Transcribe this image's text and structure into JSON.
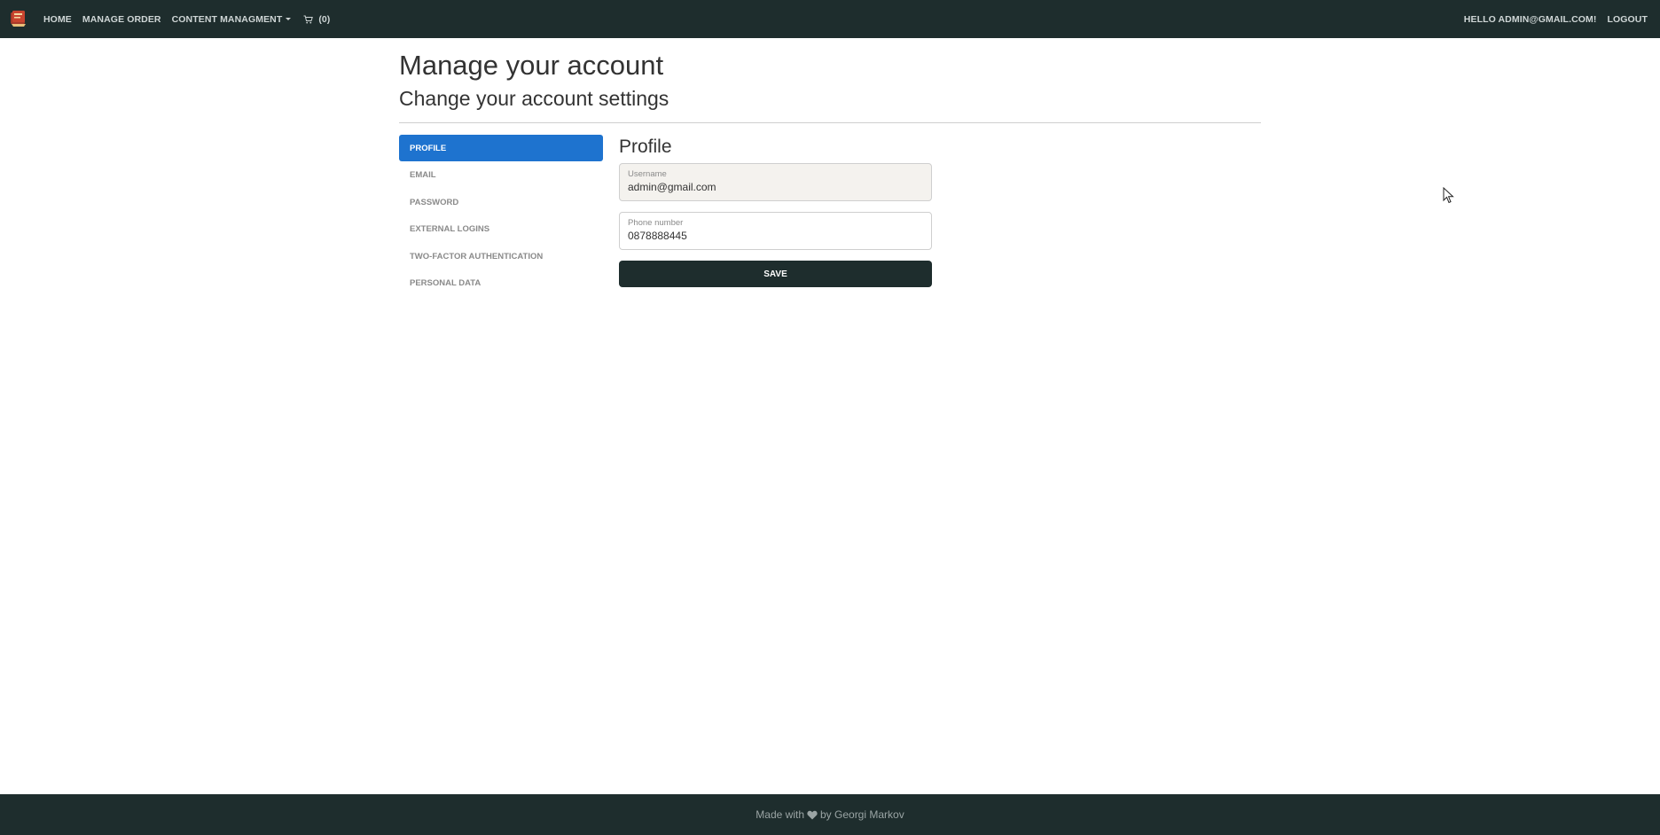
{
  "navbar": {
    "logo_icon": "book-logo-icon",
    "links": {
      "home": "HOME",
      "manage_order": "MANAGE ORDER",
      "content_management": "CONTENT MANAGMENT"
    },
    "cart": {
      "icon": "cart-icon",
      "count": "(0)"
    },
    "greeting": "HELLO ADMIN@GMAIL.COM!",
    "logout": "LOGOUT"
  },
  "header": {
    "title": "Manage your account",
    "subtitle": "Change your account settings"
  },
  "sidebar": {
    "items": [
      {
        "label": "PROFILE",
        "active": true
      },
      {
        "label": "EMAIL",
        "active": false
      },
      {
        "label": "PASSWORD",
        "active": false
      },
      {
        "label": "EXTERNAL LOGINS",
        "active": false
      },
      {
        "label": "TWO-FACTOR AUTHENTICATION",
        "active": false
      },
      {
        "label": "PERSONAL DATA",
        "active": false
      }
    ]
  },
  "profile": {
    "title": "Profile",
    "username": {
      "label": "Username",
      "value": "admin@gmail.com"
    },
    "phone": {
      "label": "Phone number",
      "value": "0878888445"
    },
    "save_label": "SAVE"
  },
  "footer": {
    "text_before": "Made with",
    "heart_icon": "heart-icon",
    "text_after": "by Georgi Markov"
  },
  "colors": {
    "navbar_bg": "#1e2d2d",
    "accent": "#1e73cf"
  }
}
